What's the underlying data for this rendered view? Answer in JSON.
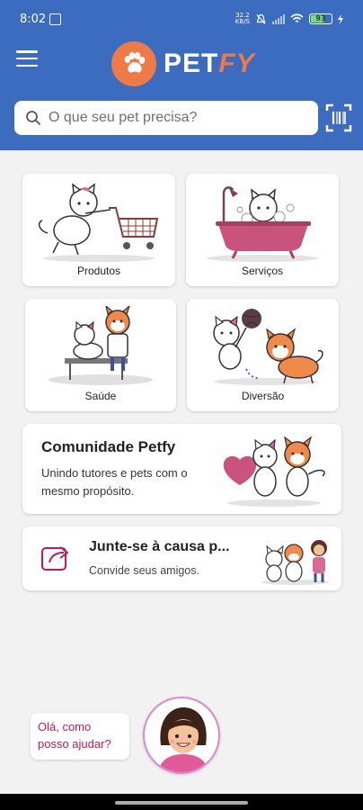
{
  "status": {
    "time": "8:02",
    "net_speed_top": "32.2",
    "net_speed_bottom": "KB/S",
    "battery": "93"
  },
  "header": {
    "logo_main": "PET",
    "logo_accent": "FY"
  },
  "search": {
    "placeholder": "O que seu pet precisa?"
  },
  "tiles": [
    {
      "label": "Produtos"
    },
    {
      "label": "Serviços"
    },
    {
      "label": "Saúde"
    },
    {
      "label": "Diversão"
    }
  ],
  "community": {
    "title": "Comunidade Petfy",
    "subtitle": "Unindo tutores e pets com o mesmo propósito."
  },
  "join": {
    "title": "Junte-se à causa p...",
    "subtitle": "Convide seus amigos."
  },
  "chat": {
    "greeting": "Olá, como posso ajudar?"
  },
  "colors": {
    "header": "#3c6cc0",
    "logo": "#f07a45",
    "accent": "#c2185b"
  }
}
